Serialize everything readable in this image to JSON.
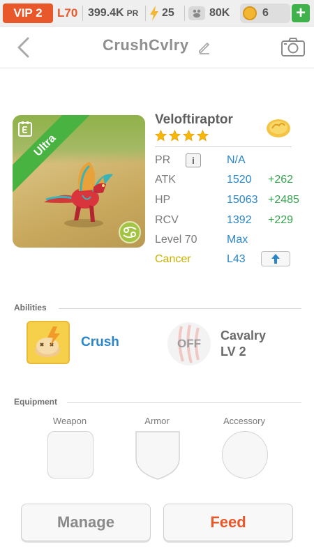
{
  "status_bar": {
    "vip": "VIP 2",
    "level": "L70",
    "power": "399.4K",
    "power_unit": "PR",
    "energy": "25",
    "food": "80K",
    "gold": "6"
  },
  "header": {
    "title": "CrushCvlry"
  },
  "dragon": {
    "name": "Veloftiraptor",
    "rarity": "Ultra",
    "stars": 4,
    "stats": [
      {
        "label": "PR",
        "value": "N/A",
        "bonus": ""
      },
      {
        "label": "ATK",
        "value": "1520",
        "bonus": "+262"
      },
      {
        "label": "HP",
        "value": "15063",
        "bonus": "+2485"
      },
      {
        "label": "RCV",
        "value": "1392",
        "bonus": "+229"
      },
      {
        "label": "Level 70",
        "value": "Max",
        "bonus": ""
      },
      {
        "label": "Cancer",
        "value": "L43",
        "bonus": ""
      }
    ]
  },
  "abilities": {
    "title": "Abilities",
    "ability1": "Crush",
    "ability2_status": "OFF",
    "ability2_name": "Cavalry",
    "ability2_level": "LV 2"
  },
  "equipment": {
    "title": "Equipment",
    "slots": [
      "Weapon",
      "Armor",
      "Accessory"
    ]
  },
  "buttons": {
    "manage": "Manage",
    "feed": "Feed"
  },
  "colors": {
    "accent_orange": "#e8582a",
    "stat_blue": "#2a85c9",
    "bonus_green": "#37a24e",
    "ultra_green": "#49b342",
    "zodiac_yellow": "#c8b000"
  }
}
